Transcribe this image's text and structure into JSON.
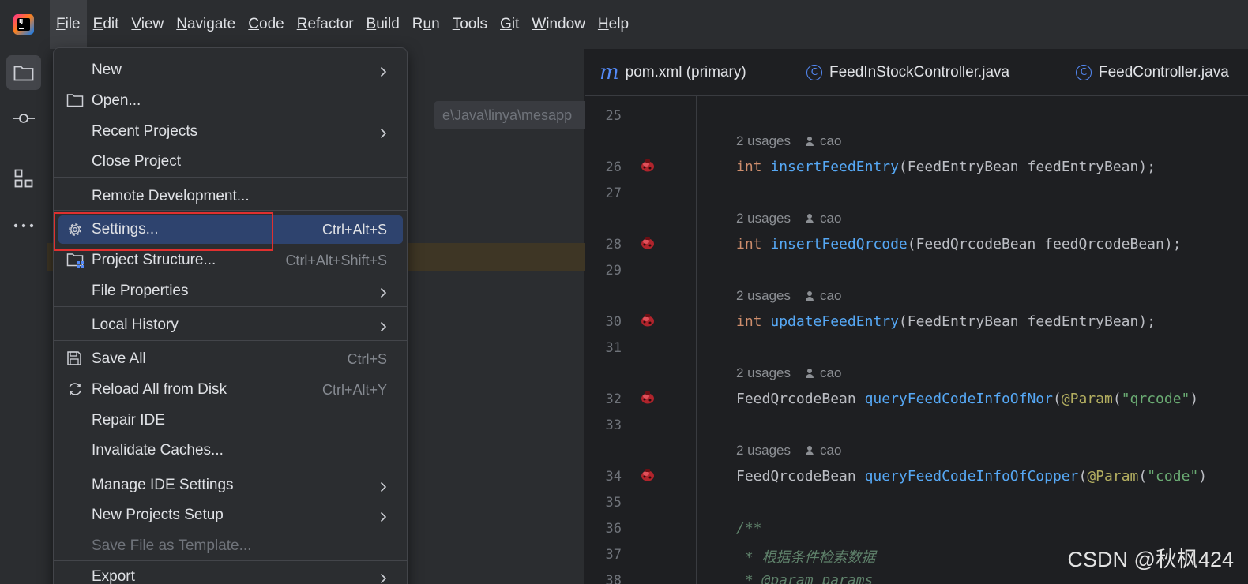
{
  "menubar": {
    "items": [
      {
        "pre": "",
        "u": "F",
        "post": "ile"
      },
      {
        "pre": "",
        "u": "E",
        "post": "dit"
      },
      {
        "pre": "",
        "u": "V",
        "post": "iew"
      },
      {
        "pre": "",
        "u": "N",
        "post": "avigate"
      },
      {
        "pre": "",
        "u": "C",
        "post": "ode"
      },
      {
        "pre": "",
        "u": "R",
        "post": "efactor"
      },
      {
        "pre": "",
        "u": "B",
        "post": "uild"
      },
      {
        "pre": "R",
        "u": "u",
        "post": "n"
      },
      {
        "pre": "",
        "u": "T",
        "post": "ools"
      },
      {
        "pre": "",
        "u": "G",
        "post": "it"
      },
      {
        "pre": "",
        "u": "W",
        "post": "indow"
      },
      {
        "pre": "",
        "u": "H",
        "post": "elp"
      }
    ]
  },
  "app_logo_text": "IJ",
  "project_panel": {
    "path": "e\\Java\\linya\\mesapp"
  },
  "file_menu": {
    "items": [
      {
        "label": "New",
        "submenu": true
      },
      {
        "label": "Open...",
        "icon": "folder-icon"
      },
      {
        "label": "Recent Projects",
        "submenu": true
      },
      {
        "label": "Close Project"
      },
      {
        "label": "Remote Development..."
      },
      {
        "label": "Settings...",
        "shortcut": "Ctrl+Alt+S",
        "icon": "gear-icon",
        "selected": true
      },
      {
        "label": "Project Structure...",
        "shortcut": "Ctrl+Alt+Shift+S",
        "icon": "project-structure-icon"
      },
      {
        "label": "File Properties",
        "submenu": true
      },
      {
        "label": "Local History",
        "submenu": true
      },
      {
        "label": "Save All",
        "shortcut": "Ctrl+S",
        "icon": "save-icon"
      },
      {
        "label": "Reload All from Disk",
        "shortcut": "Ctrl+Alt+Y",
        "icon": "reload-icon"
      },
      {
        "label": "Repair IDE"
      },
      {
        "label": "Invalidate Caches..."
      },
      {
        "label": "Manage IDE Settings",
        "submenu": true
      },
      {
        "label": "New Projects Setup",
        "submenu": true
      },
      {
        "label": "Save File as Template...",
        "disabled": true
      },
      {
        "label": "Export",
        "submenu": true
      }
    ]
  },
  "editor": {
    "tabs": [
      {
        "label": "pom.xml (primary)",
        "icon": "maven-icon",
        "icon_text": "m"
      },
      {
        "label": "FeedInStockController.java",
        "icon": "class-icon",
        "icon_text": "C"
      },
      {
        "label": "FeedController.java",
        "icon": "class-icon",
        "icon_text": "C"
      }
    ],
    "usages_text": "2 usages",
    "author": "cao",
    "lines": [
      {
        "num": "25"
      },
      {
        "num": "26",
        "hint": true,
        "tokens": [
          {
            "t": "int ",
            "c": "kw"
          },
          {
            "t": "insertFeedEntry",
            "c": "fn"
          },
          {
            "t": "(FeedEntryBean feedEntryBean);",
            "c": ""
          }
        ]
      },
      {
        "num": "27"
      },
      {
        "num": "28",
        "hint": true,
        "tokens": [
          {
            "t": "int ",
            "c": "kw"
          },
          {
            "t": "insertFeedQrcode",
            "c": "fn"
          },
          {
            "t": "(FeedQrcodeBean feedQrcodeBean);",
            "c": ""
          }
        ]
      },
      {
        "num": "29"
      },
      {
        "num": "30",
        "hint": true,
        "tokens": [
          {
            "t": "int ",
            "c": "kw"
          },
          {
            "t": "updateFeedEntry",
            "c": "fn"
          },
          {
            "t": "(FeedEntryBean feedEntryBean);",
            "c": ""
          }
        ]
      },
      {
        "num": "31"
      },
      {
        "num": "32",
        "hint": true,
        "tokens": [
          {
            "t": "FeedQrcodeBean ",
            "c": ""
          },
          {
            "t": "queryFeedCodeInfoOfNor",
            "c": "fn"
          },
          {
            "t": "(",
            "c": ""
          },
          {
            "t": "@Param",
            "c": "ann"
          },
          {
            "t": "(",
            "c": ""
          },
          {
            "t": "\"qrcode\"",
            "c": "str"
          },
          {
            "t": ")",
            "c": ""
          }
        ]
      },
      {
        "num": "33"
      },
      {
        "num": "34",
        "hint": true,
        "tokens": [
          {
            "t": "FeedQrcodeBean ",
            "c": ""
          },
          {
            "t": "queryFeedCodeInfoOfCopper",
            "c": "fn"
          },
          {
            "t": "(",
            "c": ""
          },
          {
            "t": "@Param",
            "c": "ann"
          },
          {
            "t": "(",
            "c": ""
          },
          {
            "t": "\"code\"",
            "c": "str"
          },
          {
            "t": ")",
            "c": ""
          }
        ]
      },
      {
        "num": "35"
      },
      {
        "num": "36",
        "tokens": [
          {
            "t": "/**",
            "c": "doc"
          }
        ]
      },
      {
        "num": "37",
        "tokens": [
          {
            "t": " * 根据条件检索数据",
            "c": "doc"
          }
        ]
      },
      {
        "num": "38",
        "tokens": [
          {
            "t": " * @param params",
            "c": "doc"
          }
        ]
      }
    ]
  },
  "watermark": "CSDN @秋枫424",
  "colors": {
    "accent_selection": "#2e436e",
    "focus_outline": "#e0302f",
    "keyword": "#cf8e6d",
    "function": "#56a8f5"
  }
}
